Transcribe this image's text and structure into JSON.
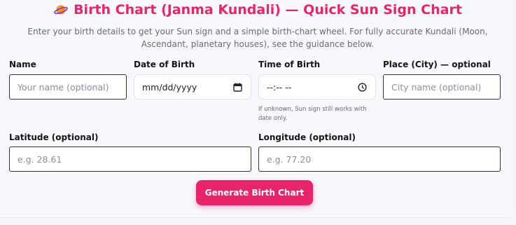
{
  "header": {
    "title": "Birth Chart (Janma Kundali) — Quick Sun Sign Chart",
    "subtitle": "Enter your birth details to get your Sun sign and a simple birth-chart wheel. For fully accurate Kundali (Moon, Ascendant, planetary houses), see the guidance below."
  },
  "form": {
    "name_label": "Name",
    "name_placeholder": "Your name (optional)",
    "dob_label": "Date of Birth",
    "dob_value": "mm/dd/yyyy",
    "tob_label": "Time of Birth",
    "tob_value": "--:-- --",
    "tob_hint": "If unknown, Sun sign still works with date only.",
    "place_label": "Place (City) — optional",
    "place_placeholder": "City name (optional)",
    "lat_label": "Latitude (optional)",
    "lat_placeholder": "e.g. 28.61",
    "lon_label": "Longitude (optional)",
    "lon_placeholder": "e.g. 77.20",
    "submit_label": "Generate Birth Chart"
  },
  "icons": {
    "title_icon": "planet-icon",
    "date_icon": "calendar-icon",
    "time_icon": "clock-icon"
  },
  "colors": {
    "accent": "#e8246a"
  }
}
